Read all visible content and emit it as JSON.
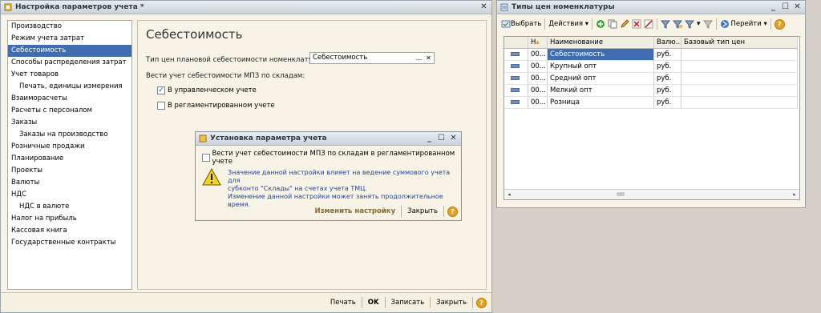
{
  "main_window": {
    "title": "Настройка параметров учета *",
    "nav_items": [
      {
        "label": "Производство",
        "sub": false
      },
      {
        "label": "Режим учета затрат",
        "sub": false
      },
      {
        "label": "Себестоимость",
        "sub": false,
        "selected": true
      },
      {
        "label": "Способы распределения затрат",
        "sub": false
      },
      {
        "label": "Учет товаров",
        "sub": false
      },
      {
        "label": "Печать, единицы измерения",
        "sub": true
      },
      {
        "label": "Взаиморасчеты",
        "sub": false
      },
      {
        "label": "Расчеты с персоналом",
        "sub": false
      },
      {
        "label": "Заказы",
        "sub": false
      },
      {
        "label": "Заказы на производство",
        "sub": true
      },
      {
        "label": "Розничные продажи",
        "sub": false
      },
      {
        "label": "Планирование",
        "sub": false
      },
      {
        "label": "Проекты",
        "sub": false
      },
      {
        "label": "Валюты",
        "sub": false
      },
      {
        "label": "НДС",
        "sub": false
      },
      {
        "label": "НДС в валюте",
        "sub": true
      },
      {
        "label": "Налог на прибыль",
        "sub": false
      },
      {
        "label": "Кассовая книга",
        "sub": false
      },
      {
        "label": "Государственные контракты",
        "sub": false
      }
    ],
    "content": {
      "heading": "Себестоимость",
      "price_type_label": "Тип цен плановой себестоимости номенклатуры:",
      "price_type_value": "Себестоимость",
      "mpz_label": "Вести учет себестоимости МПЗ по складам:",
      "cb_management": "В управленческом учете",
      "cb_management_checked": true,
      "cb_regulated": "В регламентированном учете",
      "cb_regulated_checked": false
    },
    "buttons": {
      "print": "Печать",
      "ok": "OK",
      "save": "Записать",
      "close": "Закрыть"
    }
  },
  "dialog": {
    "title": "Установка параметра учета",
    "checkbox_label": "Вести учет себестоимости МПЗ по складам в регламентированном учете",
    "checkbox_checked": false,
    "message_lines": [
      "Значение данной настройки влияет на ведение суммового учета для",
      "субконто \"Склады\" на счетах учета ТМЦ.",
      "Изменение данной настройки может занять продолжительное время."
    ],
    "change_button": "Изменить настройку",
    "close_button": "Закрыть"
  },
  "right_window": {
    "title": "Типы цен номенклатуры",
    "toolbar": {
      "select": "Выбрать",
      "actions": "Действия",
      "goto": "Перейти"
    },
    "columns": [
      "Н",
      "Наименование",
      "Валю...",
      "Базовый тип цен"
    ],
    "rows": [
      {
        "code": "00...",
        "name": "Себестоимость",
        "currency": "руб.",
        "base": "",
        "selected": true
      },
      {
        "code": "00...",
        "name": "Крупный опт",
        "currency": "руб.",
        "base": ""
      },
      {
        "code": "00...",
        "name": "Средний опт",
        "currency": "руб.",
        "base": ""
      },
      {
        "code": "00...",
        "name": "Мелкий опт",
        "currency": "руб.",
        "base": ""
      },
      {
        "code": "00...",
        "name": "Розница",
        "currency": "руб.",
        "base": ""
      }
    ]
  },
  "colors": {
    "selection": "#3f6db0",
    "message_text": "#1e46a8",
    "window_bg": "#f7f3e6",
    "desktop": "#d4d0c8"
  }
}
